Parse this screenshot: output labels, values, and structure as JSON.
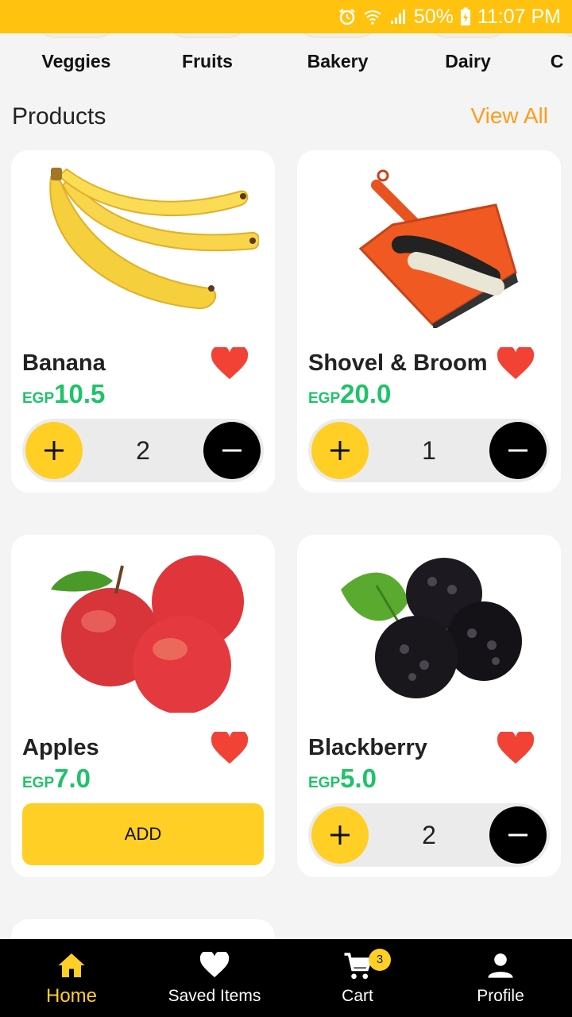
{
  "status_bar": {
    "battery": "50%",
    "time": "11:07 PM"
  },
  "categories": [
    "Veggies",
    "Fruits",
    "Bakery",
    "Dairy",
    "C"
  ],
  "section": {
    "title": "Products",
    "view_all": "View All"
  },
  "products": [
    {
      "name": "Banana",
      "currency": "EGP",
      "price": "10.5",
      "quantity": "2",
      "image": "banana-bunch",
      "favorite": true
    },
    {
      "name": "Shovel & Broom",
      "currency": "EGP",
      "price": "20.0",
      "quantity": "1",
      "image": "dustpan-and-brush",
      "favorite": true
    },
    {
      "name": "Apples",
      "currency": "EGP",
      "price": "7.0",
      "add_label": "ADD",
      "image": "red-apples",
      "favorite": true
    },
    {
      "name": "Blackberry",
      "currency": "EGP",
      "price": "5.0",
      "quantity": "2",
      "image": "blackberries",
      "favorite": true
    }
  ],
  "nav": [
    {
      "label": "Home",
      "icon": "home-icon",
      "active": true
    },
    {
      "label": "Saved Items",
      "icon": "heart-icon"
    },
    {
      "label": "Cart",
      "icon": "cart-icon",
      "badge": "3"
    },
    {
      "label": "Profile",
      "icon": "person-icon"
    }
  ],
  "colors": {
    "accent": "#ffcf26",
    "status_bar": "#ffc20e",
    "price": "#1fc36a",
    "link": "#ff9c1a",
    "heart": "#f24236"
  }
}
